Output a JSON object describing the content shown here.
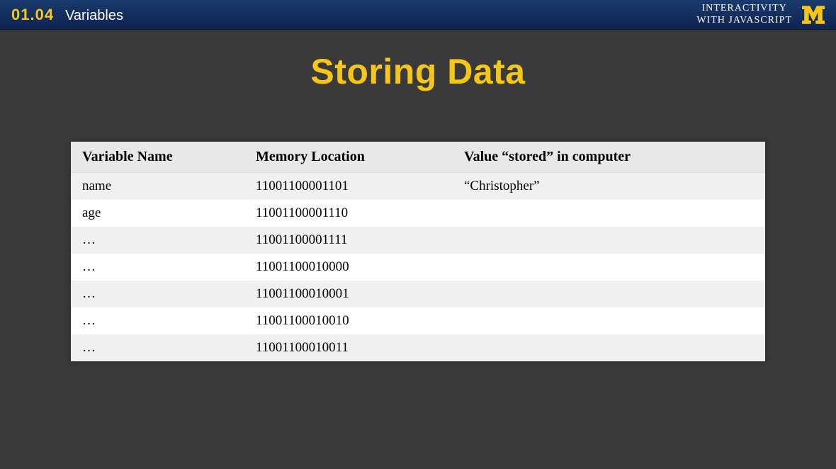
{
  "header": {
    "lesson_number": "01.04",
    "lesson_title": "Variables",
    "course_line1": "INTERACTIVITY",
    "course_line2": "WITH JAVASCRIPT"
  },
  "slide": {
    "title": "Storing Data"
  },
  "table": {
    "headers": {
      "col1": "Variable Name",
      "col2": "Memory Location",
      "col3": "Value “stored” in computer"
    },
    "rows": [
      {
        "var": "name",
        "mem": "11001100001101",
        "val": "“Christopher”"
      },
      {
        "var": "age",
        "mem": "11001100001110",
        "val": ""
      },
      {
        "var": "…",
        "mem": "11001100001111",
        "val": ""
      },
      {
        "var": "…",
        "mem": "11001100010000",
        "val": ""
      },
      {
        "var": "…",
        "mem": "11001100010001",
        "val": ""
      },
      {
        "var": "…",
        "mem": "11001100010010",
        "val": ""
      },
      {
        "var": "…",
        "mem": "11001100010011",
        "val": ""
      }
    ]
  }
}
